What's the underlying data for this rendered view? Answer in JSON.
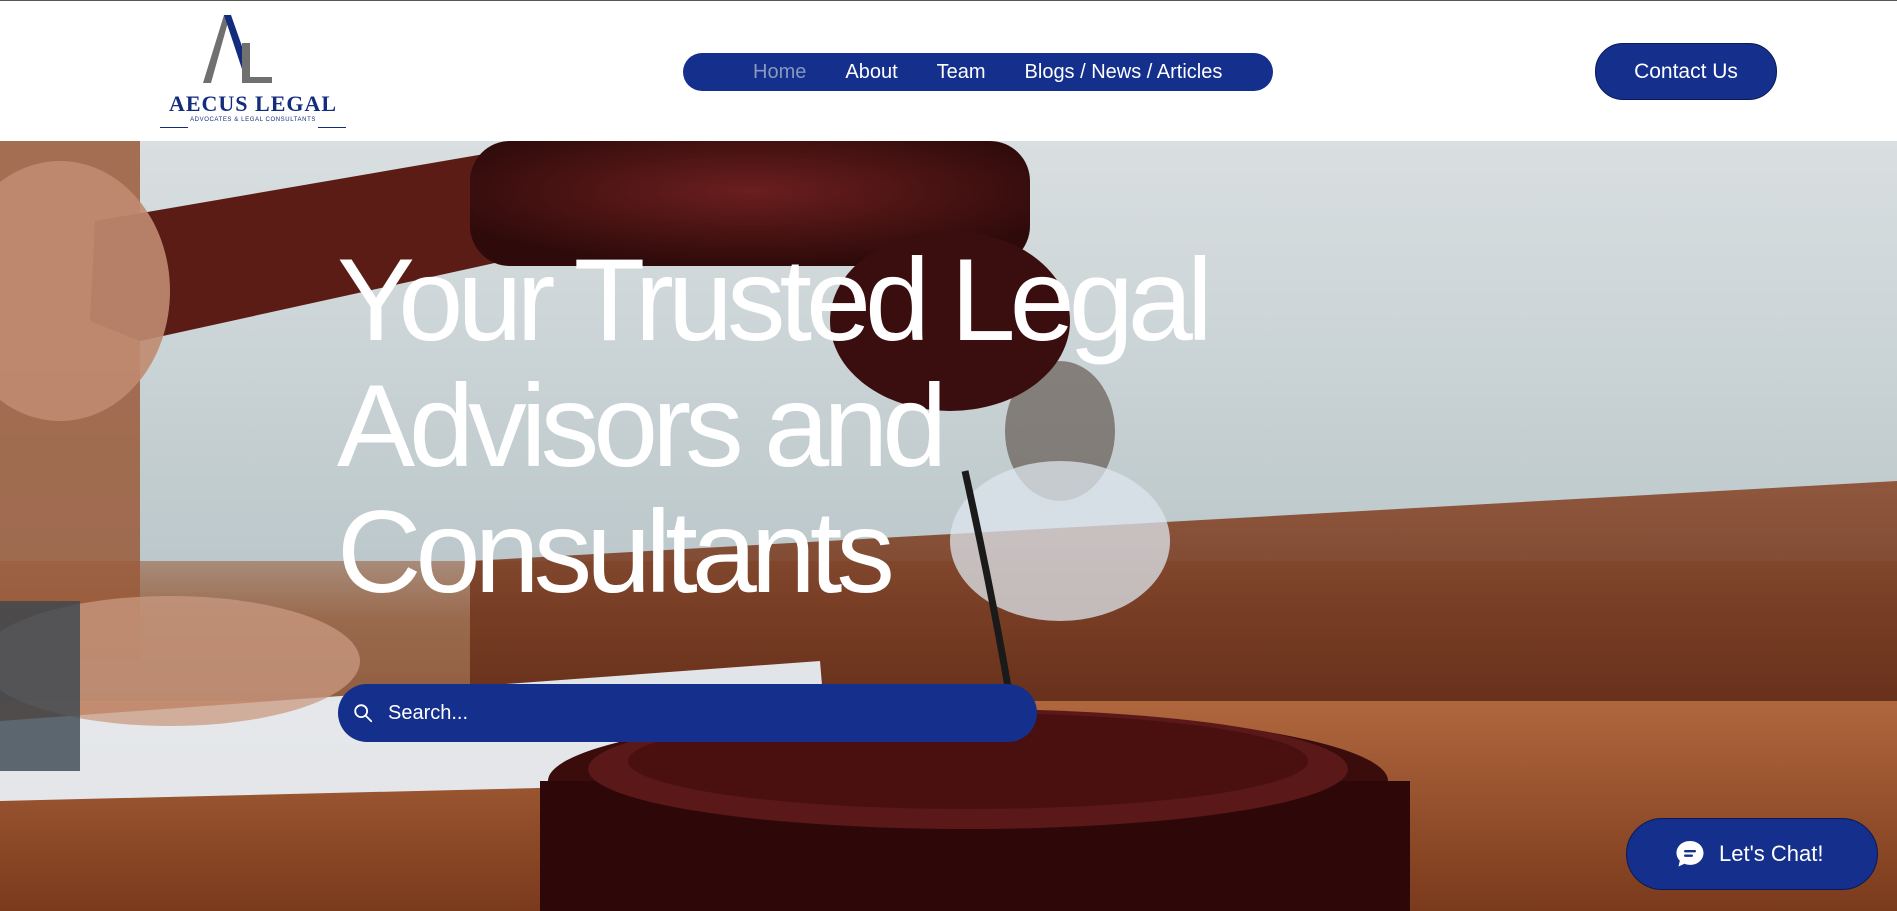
{
  "brand": {
    "name": "AECUS LEGAL",
    "tagline": "ADVOCATES & LEGAL CONSULTANTS",
    "monogram": "AL",
    "primary_color": "#142f8c",
    "accent_gray": "#707070"
  },
  "nav": {
    "items": [
      {
        "label": "Home",
        "active": true
      },
      {
        "label": "About",
        "active": false
      },
      {
        "label": "Team",
        "active": false
      },
      {
        "label": "Blogs / News / Articles",
        "active": false
      }
    ]
  },
  "header": {
    "contact_label": "Contact Us"
  },
  "hero": {
    "title_lines": [
      "Your Trusted Legal",
      "Advisors and",
      "Consultants"
    ],
    "background": "courtroom-gavel-photo"
  },
  "search": {
    "placeholder": "Search...",
    "value": "",
    "icon": "search-icon"
  },
  "chat": {
    "label": "Let's Chat!",
    "icon": "chat-bubble-icon"
  }
}
